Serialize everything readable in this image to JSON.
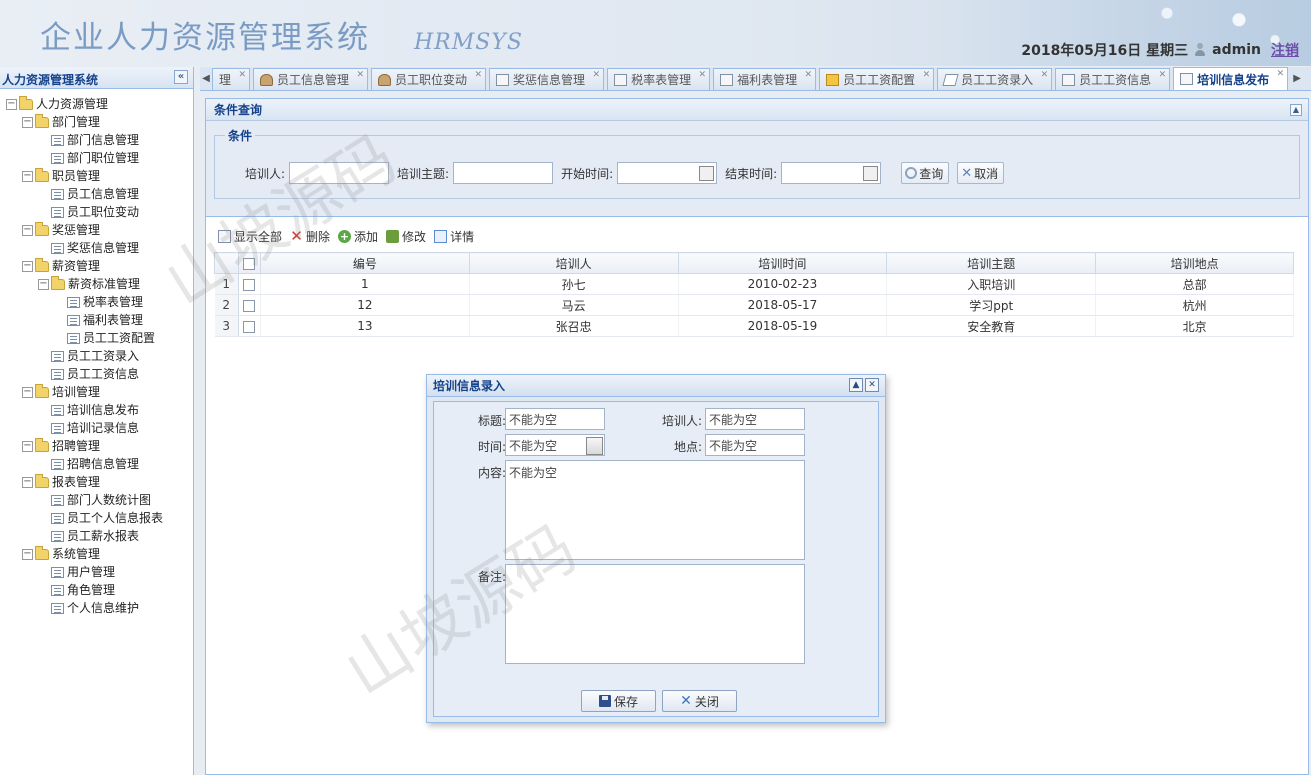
{
  "header": {
    "title": "企业人力资源管理系统",
    "subtitle": "HRMSYS",
    "date": "2018年05月16日 星期三",
    "user": "admin",
    "logout": "注销"
  },
  "sidebar": {
    "title": "人力资源管理系统",
    "tree": [
      {
        "label": "人力资源管理",
        "level": 0,
        "type": "folder"
      },
      {
        "label": "部门管理",
        "level": 1,
        "type": "folder"
      },
      {
        "label": "部门信息管理",
        "level": 2,
        "type": "file"
      },
      {
        "label": "部门职位管理",
        "level": 2,
        "type": "file"
      },
      {
        "label": "职员管理",
        "level": 1,
        "type": "folder"
      },
      {
        "label": "员工信息管理",
        "level": 2,
        "type": "file"
      },
      {
        "label": "员工职位变动",
        "level": 2,
        "type": "file"
      },
      {
        "label": "奖惩管理",
        "level": 1,
        "type": "folder"
      },
      {
        "label": "奖惩信息管理",
        "level": 2,
        "type": "file"
      },
      {
        "label": "薪资管理",
        "level": 1,
        "type": "folder"
      },
      {
        "label": "薪资标准管理",
        "level": 2,
        "type": "folder"
      },
      {
        "label": "税率表管理",
        "level": 3,
        "type": "file"
      },
      {
        "label": "福利表管理",
        "level": 3,
        "type": "file"
      },
      {
        "label": "员工工资配置",
        "level": 3,
        "type": "file"
      },
      {
        "label": "员工工资录入",
        "level": 2,
        "type": "file"
      },
      {
        "label": "员工工资信息",
        "level": 2,
        "type": "file"
      },
      {
        "label": "培训管理",
        "level": 1,
        "type": "folder"
      },
      {
        "label": "培训信息发布",
        "level": 2,
        "type": "file"
      },
      {
        "label": "培训记录信息",
        "level": 2,
        "type": "file"
      },
      {
        "label": "招聘管理",
        "level": 1,
        "type": "folder"
      },
      {
        "label": "招聘信息管理",
        "level": 2,
        "type": "file"
      },
      {
        "label": "报表管理",
        "level": 1,
        "type": "folder"
      },
      {
        "label": "部门人数统计图",
        "level": 2,
        "type": "file"
      },
      {
        "label": "员工个人信息报表",
        "level": 2,
        "type": "file"
      },
      {
        "label": "员工薪水报表",
        "level": 2,
        "type": "file"
      },
      {
        "label": "系统管理",
        "level": 1,
        "type": "folder"
      },
      {
        "label": "用户管理",
        "level": 2,
        "type": "file"
      },
      {
        "label": "角色管理",
        "level": 2,
        "type": "file"
      },
      {
        "label": "个人信息维护",
        "level": 2,
        "type": "file"
      }
    ]
  },
  "tabs": [
    {
      "label": "理",
      "icon": "file-icon",
      "active": false
    },
    {
      "label": "员工信息管理",
      "icon": "person-icon",
      "active": false
    },
    {
      "label": "员工职位变动",
      "icon": "person-icon",
      "active": false
    },
    {
      "label": "奖惩信息管理",
      "icon": "table-icon",
      "active": false
    },
    {
      "label": "税率表管理",
      "icon": "table-icon",
      "active": false
    },
    {
      "label": "福利表管理",
      "icon": "doc-icon",
      "active": false
    },
    {
      "label": "员工工资配置",
      "icon": "money-icon",
      "active": false
    },
    {
      "label": "员工工资录入",
      "icon": "pen-icon",
      "active": false
    },
    {
      "label": "员工工资信息",
      "icon": "table-icon",
      "active": false
    },
    {
      "label": "培训信息发布",
      "icon": "list-icon",
      "active": true
    }
  ],
  "filter": {
    "panel_title": "条件查询",
    "legend": "条件",
    "trainer_label": "培训人:",
    "topic_label": "培训主题:",
    "start_label": "开始时间:",
    "end_label": "结束时间:",
    "search_button": "查询",
    "cancel_button": "取消"
  },
  "toolbar": {
    "show_all": "显示全部",
    "delete": "删除",
    "add": "添加",
    "edit": "修改",
    "detail": "详情"
  },
  "grid": {
    "columns": [
      "编号",
      "培训人",
      "培训时间",
      "培训主题",
      "培训地点"
    ],
    "rows": [
      {
        "rn": "1",
        "id": "1",
        "trainer": "孙七",
        "time": "2010-02-23",
        "topic": "入职培训",
        "place": "总部"
      },
      {
        "rn": "2",
        "id": "12",
        "trainer": "马云",
        "time": "2018-05-17",
        "topic": "学习ppt",
        "place": "杭州"
      },
      {
        "rn": "3",
        "id": "13",
        "trainer": "张召忠",
        "time": "2018-05-19",
        "topic": "安全教育",
        "place": "北京"
      }
    ]
  },
  "dialog": {
    "title": "培训信息录入",
    "title_label": "标题:",
    "title_value": "不能为空",
    "trainer_label": "培训人:",
    "trainer_value": "不能为空",
    "time_label": "时间:",
    "time_value": "不能为空",
    "place_label": "地点:",
    "place_value": "不能为空",
    "content_label": "内容:",
    "content_value": "不能为空",
    "remark_label": "备注:",
    "remark_value": "",
    "save_button": "保存",
    "close_button": "关闭"
  },
  "watermark": "山坡源码"
}
